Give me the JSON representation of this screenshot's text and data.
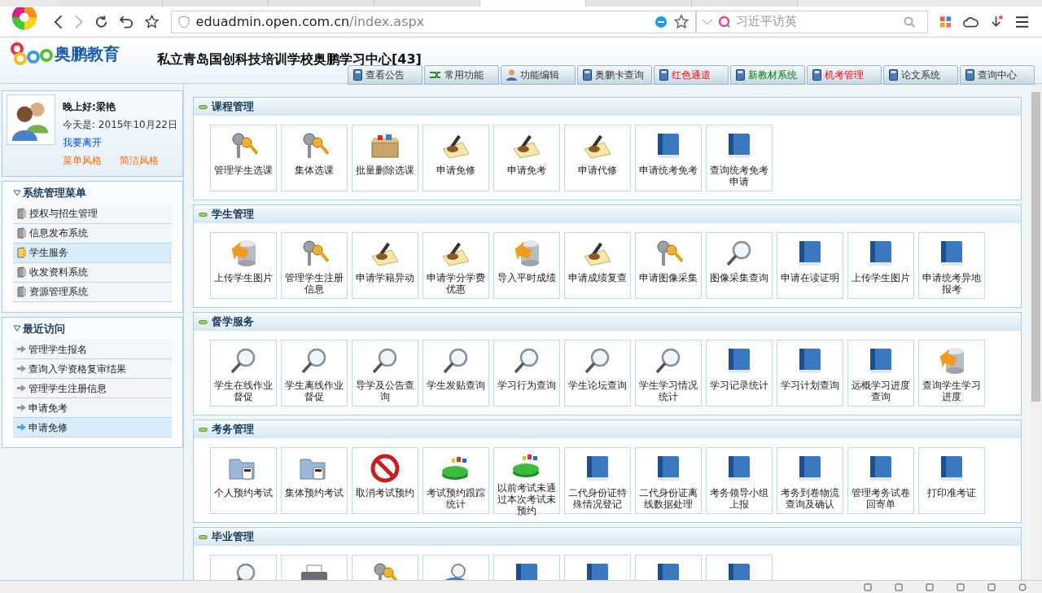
{
  "browser": {
    "tabs": [
      {
        "selected": false
      },
      {
        "selected": false
      },
      {
        "selected": false
      },
      {
        "selected": false
      },
      {
        "selected": true
      },
      {
        "selected": false
      },
      {
        "selected": false
      }
    ],
    "url_host": "eduadmin.open.com.cn",
    "url_path": "/index.aspx",
    "search_placeholder": "习近平访英"
  },
  "header": {
    "logo_text": "奥鹏教育",
    "school": "私立青岛国创科技培训学校奥鹏学习中心[43]"
  },
  "nav_tabs": [
    {
      "label": "查看公告",
      "kind": "book"
    },
    {
      "label": "常用功能",
      "kind": "arrows"
    },
    {
      "label": "功能编辑",
      "kind": "person"
    },
    {
      "label": "奥鹏卡查询",
      "kind": "book"
    },
    {
      "label": "红色通道",
      "kind": "book-red"
    },
    {
      "label": "新教材系统",
      "kind": "book-green"
    },
    {
      "label": "机考管理",
      "kind": "book-red"
    },
    {
      "label": "论文系统",
      "kind": "book"
    },
    {
      "label": "查询中心",
      "kind": "book"
    }
  ],
  "user": {
    "greeting": "晚上好:",
    "name": "梁艳",
    "date": "今天是: 2015年10月22日",
    "logout": "我要离开",
    "styles": [
      "菜单风格",
      "简洁风格"
    ]
  },
  "system_menu": {
    "title": "系统管理菜单",
    "expanded": true,
    "items": [
      {
        "label": "授权与招生管理",
        "selected": false
      },
      {
        "label": "信息发布系统",
        "selected": false
      },
      {
        "label": "学生服务",
        "selected": true
      },
      {
        "label": "收发资料系统",
        "selected": false
      },
      {
        "label": "资源管理系统",
        "selected": false
      }
    ]
  },
  "recent": {
    "title": "最近访问",
    "expanded": true,
    "items": [
      {
        "label": "管理学生报名",
        "selected": false
      },
      {
        "label": "查询入学资格复审结果",
        "selected": false
      },
      {
        "label": "管理学生注册信息",
        "selected": false
      },
      {
        "label": "申请免考",
        "selected": false
      },
      {
        "label": "申请免修",
        "selected": true
      }
    ]
  },
  "sections": [
    {
      "title": "课程管理",
      "items": [
        {
          "label": "管理学生选课",
          "kind": "key"
        },
        {
          "label": "集体选课",
          "kind": "key"
        },
        {
          "label": "批量删除选课",
          "kind": "box"
        },
        {
          "label": "申请免修",
          "kind": "pen"
        },
        {
          "label": "申请免考",
          "kind": "pen"
        },
        {
          "label": "申请代修",
          "kind": "pen"
        },
        {
          "label": "申请统考免考",
          "kind": "book"
        },
        {
          "label": "查询统考免考申请",
          "kind": "book"
        }
      ]
    },
    {
      "title": "学生管理",
      "items": [
        {
          "label": "上传学生图片",
          "kind": "db"
        },
        {
          "label": "管理学生注册信息",
          "kind": "key"
        },
        {
          "label": "申请学籍异动",
          "kind": "pen"
        },
        {
          "label": "申请学分学费优惠",
          "kind": "pen"
        },
        {
          "label": "导入平时成绩",
          "kind": "db"
        },
        {
          "label": "申请成绩复查",
          "kind": "pen"
        },
        {
          "label": "申请图像采集",
          "kind": "key"
        },
        {
          "label": "图像采集查询",
          "kind": "lens"
        },
        {
          "label": "申请在读证明",
          "kind": "book"
        },
        {
          "label": "上传学生图片",
          "kind": "book"
        },
        {
          "label": "申请统考异地报考",
          "kind": "book"
        }
      ]
    },
    {
      "title": "督学服务",
      "items": [
        {
          "label": "学生在线作业督促",
          "kind": "lens"
        },
        {
          "label": "学生离线作业督促",
          "kind": "lens"
        },
        {
          "label": "导学及公告查询",
          "kind": "lens"
        },
        {
          "label": "学生发贴查询",
          "kind": "lens"
        },
        {
          "label": "学习行为查询",
          "kind": "lens"
        },
        {
          "label": "学生论坛查询",
          "kind": "lens"
        },
        {
          "label": "学生学习情况统计",
          "kind": "lens"
        },
        {
          "label": "学习记录统计",
          "kind": "book"
        },
        {
          "label": "学习计划查询",
          "kind": "book"
        },
        {
          "label": "远概学习进度查询",
          "kind": "book"
        },
        {
          "label": "查询学生学习进度",
          "kind": "db"
        }
      ]
    },
    {
      "title": "考务管理",
      "items": [
        {
          "label": "个人预约考试",
          "kind": "folder"
        },
        {
          "label": "集体预约考试",
          "kind": "folder"
        },
        {
          "label": "取消考试预约",
          "kind": "stop"
        },
        {
          "label": "考试预约跟踪统计",
          "kind": "pie"
        },
        {
          "label": "以前考试未通过本次考试未预约",
          "kind": "pie"
        },
        {
          "label": "二代身份证特殊情况登记",
          "kind": "book"
        },
        {
          "label": "二代身份证离线数据处理",
          "kind": "book"
        },
        {
          "label": "考务领导小组上报",
          "kind": "book"
        },
        {
          "label": "考务到卷物流查询及确认",
          "kind": "book"
        },
        {
          "label": "管理考务试卷回寄单",
          "kind": "book"
        },
        {
          "label": "打印准考证",
          "kind": "book"
        }
      ]
    },
    {
      "title": "毕业管理",
      "items": [
        {
          "kind": "lens"
        },
        {
          "kind": "printer"
        },
        {
          "kind": "key"
        },
        {
          "kind": "globe"
        },
        {
          "kind": "book"
        },
        {
          "kind": "book"
        },
        {
          "kind": "book"
        },
        {
          "kind": "book"
        }
      ]
    }
  ]
}
